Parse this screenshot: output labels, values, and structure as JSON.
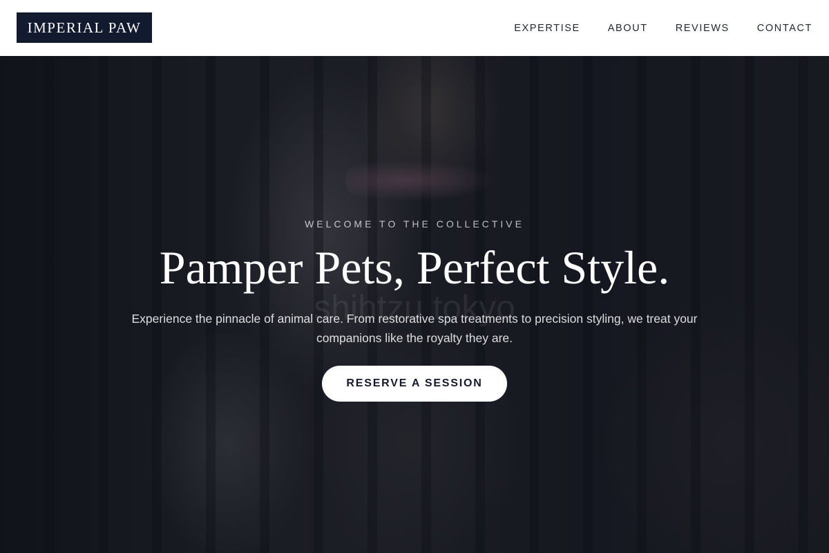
{
  "header": {
    "logo": "IMPERIAL PAW",
    "nav": [
      {
        "label": "EXPERTISE"
      },
      {
        "label": "ABOUT"
      },
      {
        "label": "REVIEWS"
      },
      {
        "label": "CONTACT"
      }
    ]
  },
  "hero": {
    "watermark": "shihtzu tokyo",
    "eyebrow": "WELCOME TO THE COLLECTIVE",
    "headline": "Pamper Pets, Perfect Style.",
    "subtext": "Experience the pinnacle of animal care. From restorative spa treatments to precision styling, we treat your companions like the royalty they are.",
    "cta_label": "RESERVE A SESSION"
  },
  "colors": {
    "header_bg": "#ffffff",
    "logo_bg": "#111a2e",
    "cta_bg": "#ffffff",
    "cta_text": "#141a2a"
  }
}
